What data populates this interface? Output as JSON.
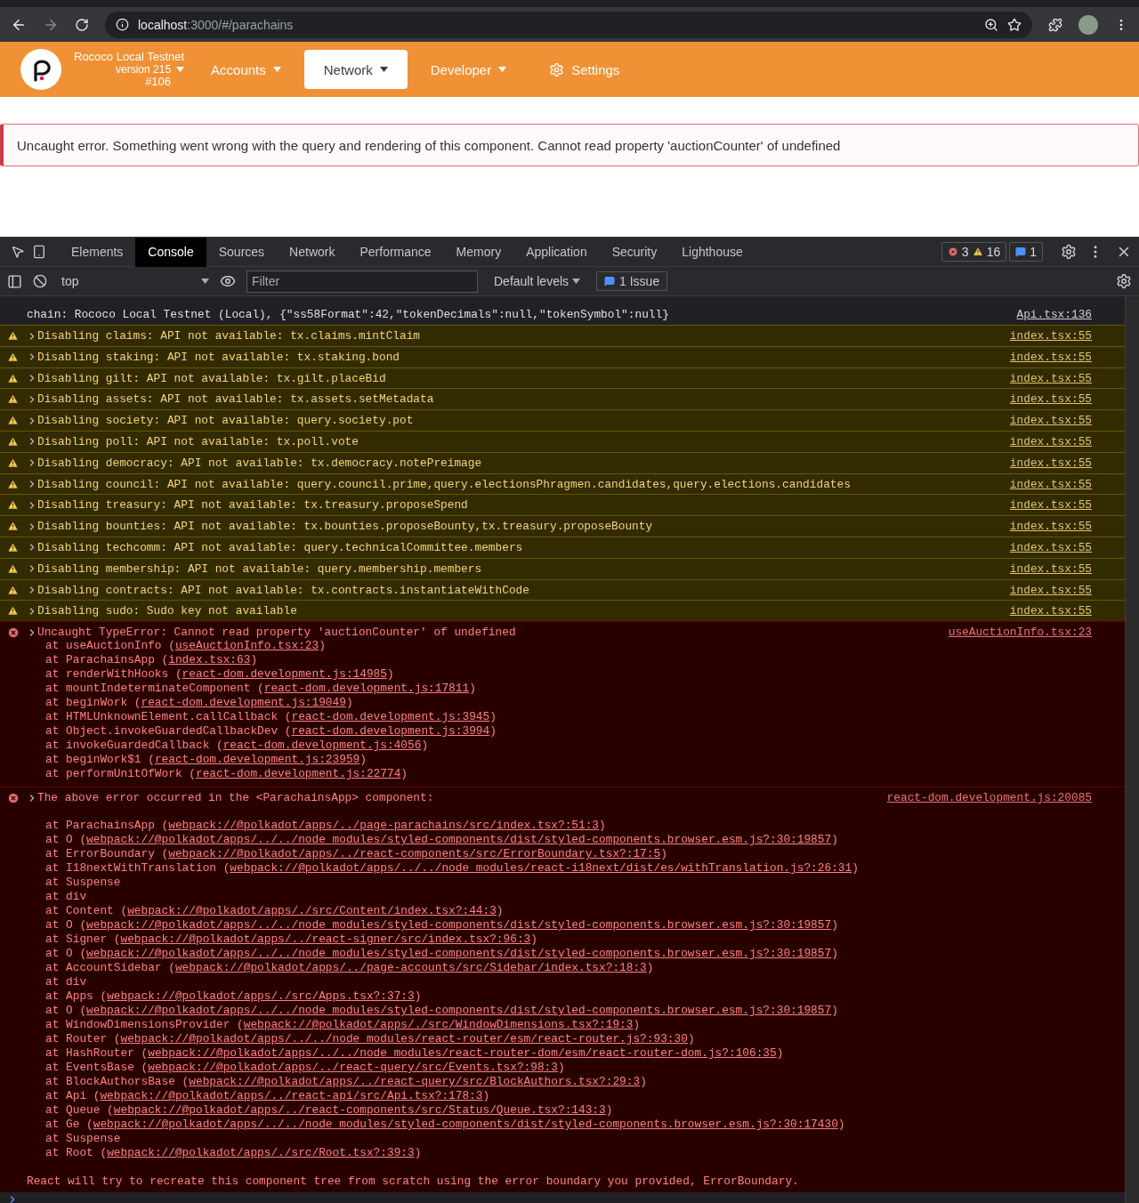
{
  "browser": {
    "host": "localhost",
    "path": ":3000/#/parachains"
  },
  "header": {
    "chain": "Rococo Local Testnet",
    "version": "version 215",
    "block": "#106",
    "nav": [
      {
        "label": "Accounts",
        "kind": "menu",
        "selected": false
      },
      {
        "label": "Network",
        "kind": "menu",
        "selected": true
      },
      {
        "label": "Developer",
        "kind": "menu",
        "selected": false
      },
      {
        "label": "Settings",
        "kind": "settings",
        "selected": false
      }
    ]
  },
  "error_banner": "Uncaught error. Something went wrong with the query and rendering of this component. Cannot read property 'auctionCounter' of undefined",
  "devtools": {
    "tabs": [
      {
        "label": "Elements",
        "selected": false
      },
      {
        "label": "Console",
        "selected": true
      },
      {
        "label": "Sources",
        "selected": false
      },
      {
        "label": "Network",
        "selected": false
      },
      {
        "label": "Performance",
        "selected": false
      },
      {
        "label": "Memory",
        "selected": false
      },
      {
        "label": "Application",
        "selected": false
      },
      {
        "label": "Security",
        "selected": false
      },
      {
        "label": "Lighthouse",
        "selected": false
      }
    ],
    "errors": "3",
    "warnings": "16",
    "issues_count": "1",
    "context": "top",
    "filter_placeholder": "Filter",
    "levels": "Default levels",
    "issues": "1 Issue",
    "messages": [
      {
        "kind": "log",
        "text": "chain: Rococo Local Testnet (Local), {\"ss58Format\":42,\"tokenDecimals\":null,\"tokenSymbol\":null}",
        "source": "Api.tsx:136"
      },
      {
        "kind": "warning",
        "text": "Disabling claims: API not available: tx.claims.mintClaim",
        "source": "index.tsx:55"
      },
      {
        "kind": "warning",
        "text": "Disabling staking: API not available: tx.staking.bond",
        "source": "index.tsx:55"
      },
      {
        "kind": "warning",
        "text": "Disabling gilt: API not available: tx.gilt.placeBid",
        "source": "index.tsx:55"
      },
      {
        "kind": "warning",
        "text": "Disabling assets: API not available: tx.assets.setMetadata",
        "source": "index.tsx:55"
      },
      {
        "kind": "warning",
        "text": "Disabling society: API not available: query.society.pot",
        "source": "index.tsx:55"
      },
      {
        "kind": "warning",
        "text": "Disabling poll: API not available: tx.poll.vote",
        "source": "index.tsx:55"
      },
      {
        "kind": "warning",
        "text": "Disabling democracy: API not available: tx.democracy.notePreimage",
        "source": "index.tsx:55"
      },
      {
        "kind": "warning",
        "text": "Disabling council: API not available: query.council.prime,query.electionsPhragmen.candidates,query.elections.candidates",
        "source": "index.tsx:55"
      },
      {
        "kind": "warning",
        "text": "Disabling treasury: API not available: tx.treasury.proposeSpend",
        "source": "index.tsx:55"
      },
      {
        "kind": "warning",
        "text": "Disabling bounties: API not available: tx.bounties.proposeBounty,tx.treasury.proposeBounty",
        "source": "index.tsx:55"
      },
      {
        "kind": "warning",
        "text": "Disabling techcomm: API not available: query.technicalCommittee.members",
        "source": "index.tsx:55"
      },
      {
        "kind": "warning",
        "text": "Disabling membership: API not available: query.membership.members",
        "source": "index.tsx:55"
      },
      {
        "kind": "warning",
        "text": "Disabling contracts: API not available: tx.contracts.instantiateWithCode",
        "source": "index.tsx:55"
      },
      {
        "kind": "warning",
        "text": "Disabling sudo: Sudo key not available",
        "source": "index.tsx:55"
      },
      {
        "kind": "error",
        "text": "Uncaught TypeError: Cannot read property 'auctionCounter' of undefined",
        "source": "useAuctionInfo.tsx:23",
        "stack": [
          {
            "text": "at useAuctionInfo (",
            "link": "useAuctionInfo.tsx:23",
            "after": ")"
          },
          {
            "text": "at ParachainsApp (",
            "link": "index.tsx:63",
            "after": ")"
          },
          {
            "text": "at renderWithHooks (",
            "link": "react-dom.development.js:14985",
            "after": ")"
          },
          {
            "text": "at mountIndeterminateComponent (",
            "link": "react-dom.development.js:17811",
            "after": ")"
          },
          {
            "text": "at beginWork (",
            "link": "react-dom.development.js:19049",
            "after": ")"
          },
          {
            "text": "at HTMLUnknownElement.callCallback (",
            "link": "react-dom.development.js:3945",
            "after": ")"
          },
          {
            "text": "at Object.invokeGuardedCallbackDev (",
            "link": "react-dom.development.js:3994",
            "after": ")"
          },
          {
            "text": "at invokeGuardedCallback (",
            "link": "react-dom.development.js:4056",
            "after": ")"
          },
          {
            "text": "at beginWork$1 (",
            "link": "react-dom.development.js:23959",
            "after": ")"
          },
          {
            "text": "at performUnitOfWork (",
            "link": "react-dom.development.js:22774",
            "after": ")"
          }
        ]
      },
      {
        "kind": "component-error",
        "text": "The above error occurred in the <ParachainsApp> component:",
        "source": "react-dom.development.js:20085",
        "stack": [
          {
            "text": "at ParachainsApp (",
            "link": "webpack://@polkadot/apps/../page-parachains/src/index.tsx?:51:3",
            "after": ")"
          },
          {
            "text": "at O (",
            "link": "webpack://@polkadot/apps/../../node_modules/styled-components/dist/styled-components.browser.esm.js?:30:19857",
            "after": ")"
          },
          {
            "text": "at ErrorBoundary (",
            "link": "webpack://@polkadot/apps/../react-components/src/ErrorBoundary.tsx?:17:5",
            "after": ")"
          },
          {
            "text": "at I18nextWithTranslation (",
            "link": "webpack://@polkadot/apps/../../node_modules/react-i18next/dist/es/withTranslation.js?:26:31",
            "after": ")"
          },
          {
            "text": "at Suspense"
          },
          {
            "text": "at div"
          },
          {
            "text": "at Content (",
            "link": "webpack://@polkadot/apps/./src/Content/index.tsx?:44:3",
            "after": ")"
          },
          {
            "text": "at O (",
            "link": "webpack://@polkadot/apps/../../node_modules/styled-components/dist/styled-components.browser.esm.js?:30:19857",
            "after": ")"
          },
          {
            "text": "at Signer (",
            "link": "webpack://@polkadot/apps/../react-signer/src/index.tsx?:96:3",
            "after": ")"
          },
          {
            "text": "at O (",
            "link": "webpack://@polkadot/apps/../../node_modules/styled-components/dist/styled-components.browser.esm.js?:30:19857",
            "after": ")"
          },
          {
            "text": "at AccountSidebar (",
            "link": "webpack://@polkadot/apps/../page-accounts/src/Sidebar/index.tsx?:18:3",
            "after": ")"
          },
          {
            "text": "at div"
          },
          {
            "text": "at Apps (",
            "link": "webpack://@polkadot/apps/./src/Apps.tsx?:37:3",
            "after": ")"
          },
          {
            "text": "at O (",
            "link": "webpack://@polkadot/apps/../../node_modules/styled-components/dist/styled-components.browser.esm.js?:30:19857",
            "after": ")"
          },
          {
            "text": "at WindowDimensionsProvider (",
            "link": "webpack://@polkadot/apps/./src/WindowDimensions.tsx?:19:3",
            "after": ")"
          },
          {
            "text": "at Router (",
            "link": "webpack://@polkadot/apps/../../node_modules/react-router/esm/react-router.js?:93:30",
            "after": ")"
          },
          {
            "text": "at HashRouter (",
            "link": "webpack://@polkadot/apps/../../node_modules/react-router-dom/esm/react-router-dom.js?:106:35",
            "after": ")"
          },
          {
            "text": "at EventsBase (",
            "link": "webpack://@polkadot/apps/../react-query/src/Events.tsx?:98:3",
            "after": ")"
          },
          {
            "text": "at BlockAuthorsBase (",
            "link": "webpack://@polkadot/apps/../react-query/src/BlockAuthors.tsx?:29:3",
            "after": ")"
          },
          {
            "text": "at Api (",
            "link": "webpack://@polkadot/apps/../react-api/src/Api.tsx?:178:3",
            "after": ")"
          },
          {
            "text": "at Queue (",
            "link": "webpack://@polkadot/apps/../react-components/src/Status/Queue.tsx?:143:3",
            "after": ")"
          },
          {
            "text": "at Ge (",
            "link": "webpack://@polkadot/apps/../../node_modules/styled-components/dist/styled-components.browser.esm.js?:30:17430",
            "after": ")"
          },
          {
            "text": "at Suspense"
          },
          {
            "text": "at Root (",
            "link": "webpack://@polkadot/apps/./src/Root.tsx?:39:3",
            "after": ")"
          }
        ],
        "footer": "React will try to recreate this component tree from scratch using the error boundary you provided, ErrorBoundary."
      }
    ]
  }
}
